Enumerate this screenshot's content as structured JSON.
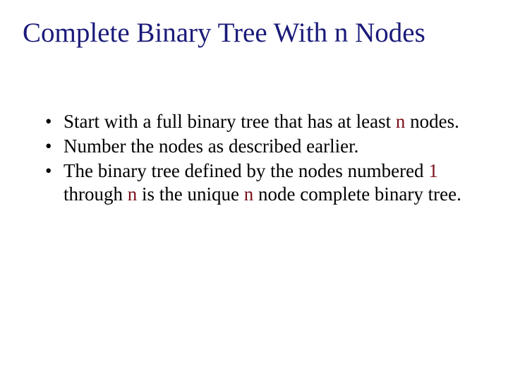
{
  "title": "Complete Binary Tree With n Nodes",
  "bullets": [
    {
      "pre": "Start with a full binary tree that has at least ",
      "kw1": "n",
      "post": " nodes."
    },
    {
      "pre": "Number the nodes as described earlier.",
      "kw1": "",
      "post": ""
    },
    {
      "pre": "The binary tree defined by the nodes numbered ",
      "kw1": "1",
      "mid": " through ",
      "kw2": "n",
      "mid2": " is the unique ",
      "kw3": "n",
      "post": " node complete binary tree."
    }
  ]
}
